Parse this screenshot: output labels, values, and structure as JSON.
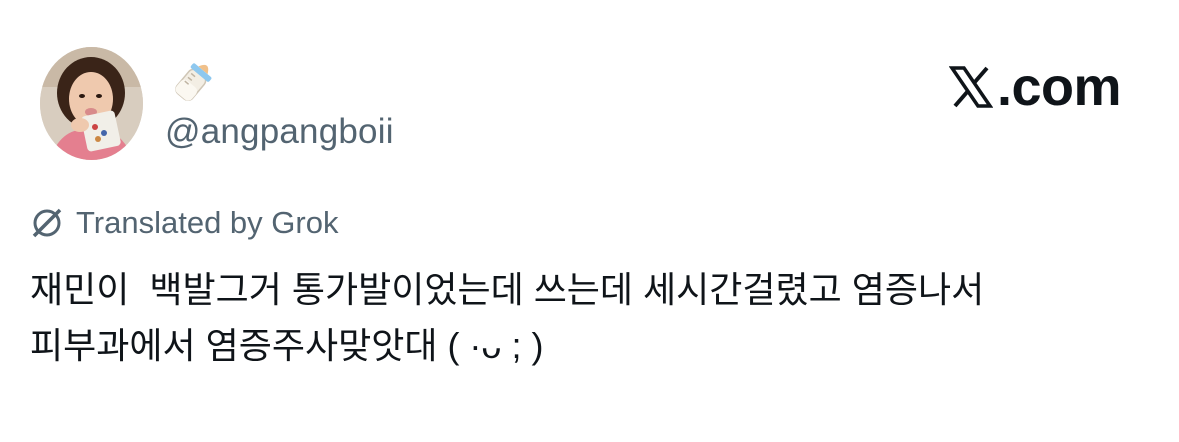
{
  "author": {
    "display_name": "🍼",
    "display_name_icon": "baby-bottle-icon",
    "handle": "@angpangboii",
    "avatar": "avatar"
  },
  "brand": {
    "logo_icon": "x-logo-icon",
    "label": ".com"
  },
  "translation": {
    "icon": "grok-icon",
    "label": "Translated by Grok"
  },
  "tweet": {
    "text": "재민이  백발그거 통가발이었는데 쓰는데 세시간걸렸고 염증나서\n피부과에서 염증주사맞앗대 ( ·ᴗ ; )"
  },
  "colors": {
    "text": "#0f1419",
    "secondary": "#536471",
    "background": "#ffffff"
  }
}
